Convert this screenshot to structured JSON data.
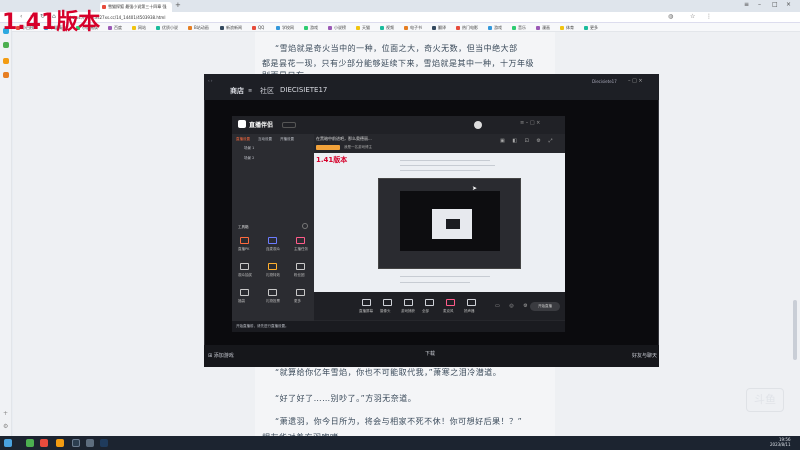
{
  "overlay": {
    "label": "1.41版本"
  },
  "browser": {
    "tab_title": "雪猫探狐 最强小说第三十四章 强",
    "url": "https://www.xs27xs.cc/14_14401/4503938.html",
    "bookmarks": [
      "小白榜",
      "小说精选",
      "小说阅读",
      "百度",
      "网站",
      "优质小说",
      "B站动画",
      "新浪新闻",
      "QQ",
      "学校网",
      "游戏",
      "小说榜",
      "天猫",
      "视频",
      "电子书",
      "翻译",
      "热门电影",
      "游戏",
      "音乐",
      "漫画",
      "体育",
      "更多"
    ]
  },
  "article": {
    "para_top_1": "“雪焰就是奇火当中的一种，位面之大，奇火无数，但当中绝大部",
    "para_top_2": "都是昙花一现，只有少部分能够延续下来，雪焰就是其中一种，十万年级",
    "para_top_3": "别而是只有......",
    "para_b1": "“就算给你亿年雪焰，你也不可能取代我，”萧寒之泪冷潜道。",
    "para_b2": "“好了好了……别吵了。”方羽无奈道。",
    "para_b3": "“萧遗羽，你今日所为，将会与相家不死不休！你可想好后果！？”",
    "para_b4": "相友华对着方羽咆哮"
  },
  "video_app": {
    "tab_store": "商店",
    "tab_community": "社区",
    "channel": "DIECISIETE17",
    "user": "Diecisiete17",
    "footer_left": "添加游戏",
    "footer_center": "下载",
    "footer_right": "好友与聊天"
  },
  "stream_app": {
    "logo": "直播伴侣",
    "title": "在黑暗中前进吧，那么奥德丽...",
    "sub": "我是一名游戏博主",
    "left_tabs": [
      "直播设置",
      "互动设置",
      "开播设置"
    ],
    "scenes": [
      "场景 1",
      "场景 2"
    ],
    "tools_header": "工具箱",
    "tools": [
      "直播PK",
      "连麦观众",
      "主播任务",
      "观众抽奖",
      "礼物特效",
      "粉丝团",
      "福袋",
      "礼物投票",
      "更多"
    ],
    "bottom_tools": [
      "直播屏幕",
      "摄像头",
      "游戏捕获",
      "全部",
      "麦克风",
      "扬声器"
    ],
    "start_button": "开始直播",
    "status_text": "开始直播前，请先进行直播设置。",
    "overlay_small": "1.41版本"
  },
  "taskbar": {
    "time": "19:56",
    "date": "2023/8/11"
  },
  "watermark": "斗鱼"
}
